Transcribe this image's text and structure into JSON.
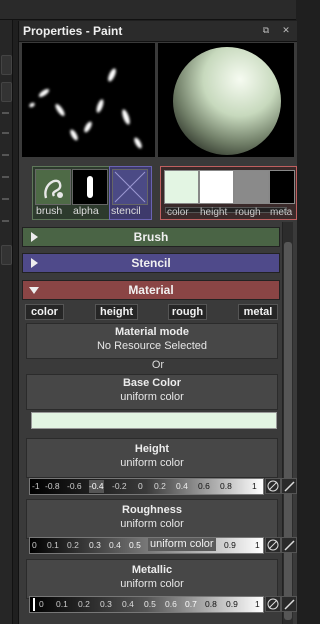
{
  "panel": {
    "title": "Properties - Paint",
    "window_icons": [
      "restore-icon",
      "close-icon"
    ]
  },
  "thumbnails": {
    "brush_label": "brush",
    "alpha_label": "alpha",
    "stencil_label": "stencil",
    "channel_swatch_labels": [
      "color",
      "height",
      "rough",
      "meta"
    ]
  },
  "sections": {
    "brush": "Brush",
    "stencil": "Stencil",
    "material": "Material"
  },
  "channel_buttons": [
    "color",
    "height",
    "rough",
    "metal"
  ],
  "material_mode": {
    "title": "Material mode",
    "value": "No Resource Selected",
    "or": "Or"
  },
  "base_color": {
    "title": "Base Color",
    "subtitle": "uniform color",
    "color": "#e3f5e3"
  },
  "height": {
    "title": "Height",
    "subtitle": "uniform color",
    "ticks": [
      "-1",
      "-0.8",
      "-0.6",
      "-0.4",
      "-0.2",
      "0",
      "0.2",
      "0.4",
      "0.6",
      "0.8",
      "1"
    ]
  },
  "roughness": {
    "title": "Roughness",
    "subtitle": "uniform color",
    "ticks": [
      "0",
      "0.1",
      "0.2",
      "0.3",
      "0.4",
      "0.5",
      "uniform color",
      "0.9",
      "1"
    ]
  },
  "metallic": {
    "title": "Metallic",
    "subtitle": "uniform color",
    "ticks": [
      "0",
      "0.1",
      "0.2",
      "0.3",
      "0.4",
      "0.5",
      "0.6",
      "0.7",
      "0.8",
      "0.9",
      "1"
    ]
  },
  "colors": {
    "brush_section": "#4a6445",
    "stencil_section": "#4f4a8a",
    "material_section": "#8a4545",
    "selection_outline": "#c06060"
  }
}
